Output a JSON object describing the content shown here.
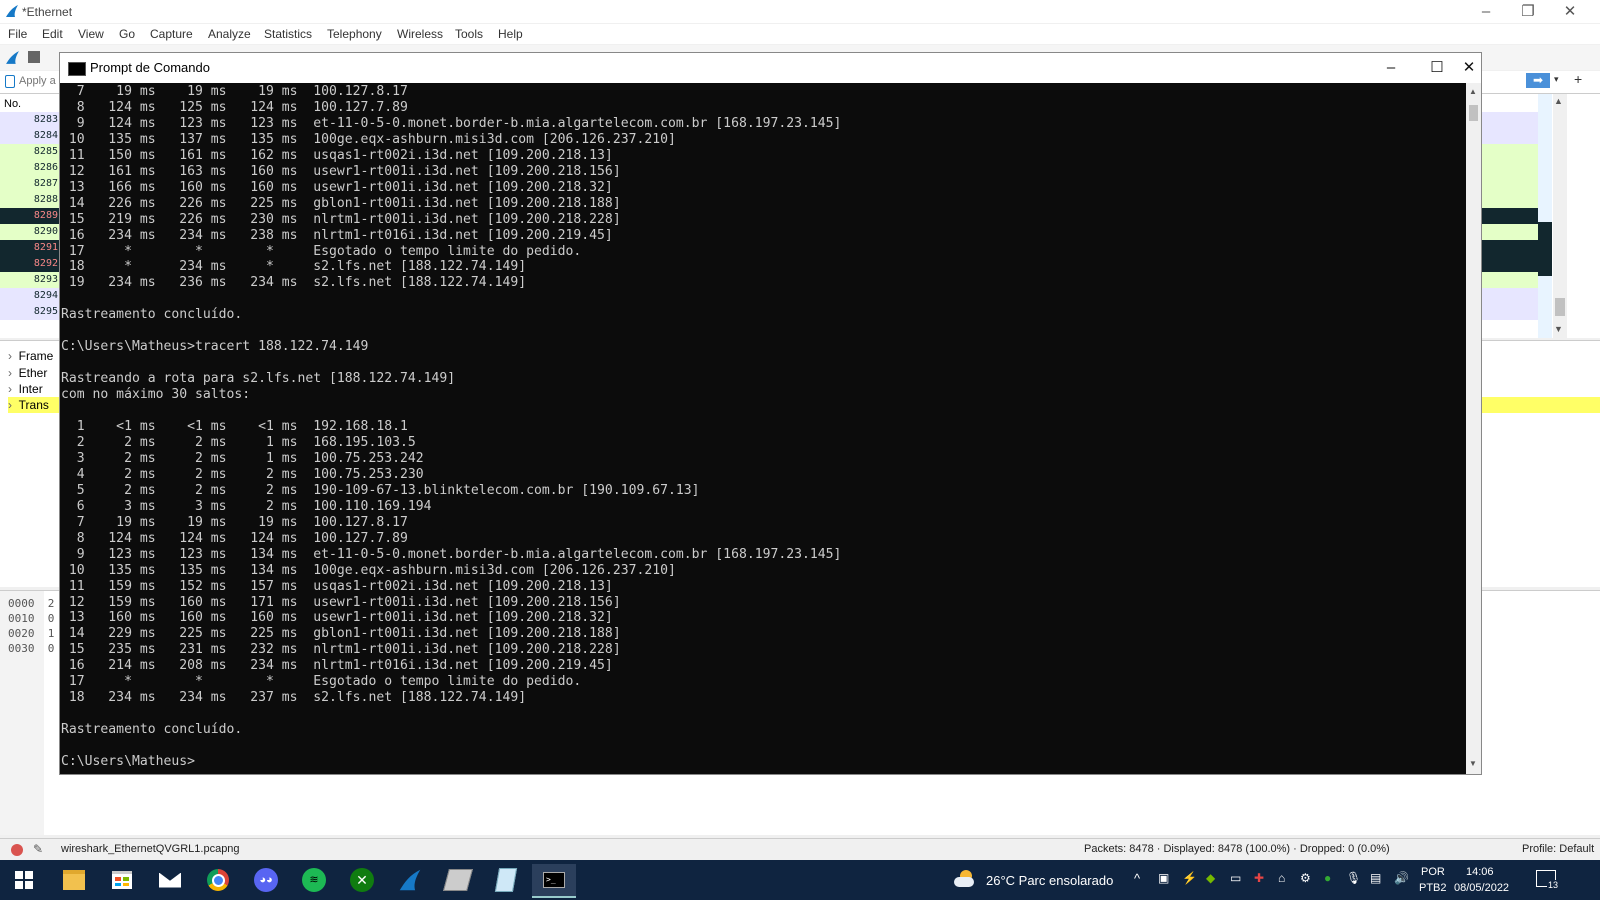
{
  "wireshark": {
    "title": "*Ethernet",
    "menu": [
      "File",
      "Edit",
      "View",
      "Go",
      "Capture",
      "Analyze",
      "Statistics",
      "Telephony",
      "Wireless",
      "Tools",
      "Help"
    ],
    "filter_placeholder": "Apply a",
    "list_header_no": "No.",
    "packets": [
      {
        "no": "8283",
        "bg": "#e7e6ff",
        "fg": "#12272e"
      },
      {
        "no": "8284",
        "bg": "#e7e6ff",
        "fg": "#12272e"
      },
      {
        "no": "8285",
        "bg": "#e4ffc7",
        "fg": "#12272e"
      },
      {
        "no": "8286",
        "bg": "#e4ffc7",
        "fg": "#12272e"
      },
      {
        "no": "8287",
        "bg": "#e4ffc7",
        "fg": "#12272e"
      },
      {
        "no": "8288",
        "bg": "#e4ffc7",
        "fg": "#12272e"
      },
      {
        "no": "8289",
        "bg": "#12272e",
        "fg": "#f78787"
      },
      {
        "no": "8290",
        "bg": "#e4ffc7",
        "fg": "#12272e"
      },
      {
        "no": "8291",
        "bg": "#12272e",
        "fg": "#f78787"
      },
      {
        "no": "8292",
        "bg": "#12272e",
        "fg": "#f78787"
      },
      {
        "no": "8293",
        "bg": "#e4ffc7",
        "fg": "#12272e"
      },
      {
        "no": "8294",
        "bg": "#e7e6ff",
        "fg": "#12272e"
      },
      {
        "no": "8295",
        "bg": "#e7e6ff",
        "fg": "#12272e"
      }
    ],
    "details": [
      "Frame",
      "Ether",
      "Inter",
      "Trans"
    ],
    "hex_offsets": [
      "0000",
      "0010",
      "0020",
      "0030"
    ],
    "hex_peek": [
      "2",
      "0",
      "1",
      "0"
    ],
    "status": {
      "file": "wireshark_EthernetQVGRL1.pcapng",
      "packets": "Packets: 8478 · Displayed: 8478 (100.0%) · Dropped: 0 (0.0%)",
      "profile": "Profile: Default"
    }
  },
  "cmd": {
    "title": "Prompt de Comando",
    "lines": [
      "  7    19 ms    19 ms    19 ms  100.127.8.17",
      "  8   124 ms   125 ms   124 ms  100.127.7.89",
      "  9   124 ms   123 ms   123 ms  et-11-0-5-0.monet.border-b.mia.algartelecom.com.br [168.197.23.145]",
      " 10   135 ms   137 ms   135 ms  100ge.eqx-ashburn.misi3d.com [206.126.237.210]",
      " 11   150 ms   161 ms   162 ms  usqas1-rt002i.i3d.net [109.200.218.13]",
      " 12   161 ms   163 ms   160 ms  usewr1-rt001i.i3d.net [109.200.218.156]",
      " 13   166 ms   160 ms   160 ms  usewr1-rt001i.i3d.net [109.200.218.32]",
      " 14   226 ms   226 ms   225 ms  gblon1-rt001i.i3d.net [109.200.218.188]",
      " 15   219 ms   226 ms   230 ms  nlrtm1-rt001i.i3d.net [109.200.218.228]",
      " 16   234 ms   234 ms   238 ms  nlrtm1-rt016i.i3d.net [109.200.219.45]",
      " 17     *        *        *     Esgotado o tempo limite do pedido.",
      " 18     *      234 ms     *     s2.lfs.net [188.122.74.149]",
      " 19   234 ms   236 ms   234 ms  s2.lfs.net [188.122.74.149]",
      "",
      "Rastreamento concluído.",
      "",
      "C:\\Users\\Matheus>tracert 188.122.74.149",
      "",
      "Rastreando a rota para s2.lfs.net [188.122.74.149]",
      "com no máximo 30 saltos:",
      "",
      "  1    <1 ms    <1 ms    <1 ms  192.168.18.1",
      "  2     2 ms     2 ms     1 ms  168.195.103.5",
      "  3     2 ms     2 ms     1 ms  100.75.253.242",
      "  4     2 ms     2 ms     2 ms  100.75.253.230",
      "  5     2 ms     2 ms     2 ms  190-109-67-13.blinktelecom.com.br [190.109.67.13]",
      "  6     3 ms     3 ms     2 ms  100.110.169.194",
      "  7    19 ms    19 ms    19 ms  100.127.8.17",
      "  8   124 ms   124 ms   124 ms  100.127.7.89",
      "  9   123 ms   123 ms   134 ms  et-11-0-5-0.monet.border-b.mia.algartelecom.com.br [168.197.23.145]",
      " 10   135 ms   135 ms   134 ms  100ge.eqx-ashburn.misi3d.com [206.126.237.210]",
      " 11   159 ms   152 ms   157 ms  usqas1-rt002i.i3d.net [109.200.218.13]",
      " 12   159 ms   160 ms   171 ms  usewr1-rt001i.i3d.net [109.200.218.156]",
      " 13   160 ms   160 ms   160 ms  usewr1-rt001i.i3d.net [109.200.218.32]",
      " 14   229 ms   225 ms   225 ms  gblon1-rt001i.i3d.net [109.200.218.188]",
      " 15   235 ms   231 ms   232 ms  nlrtm1-rt001i.i3d.net [109.200.218.228]",
      " 16   214 ms   208 ms   234 ms  nlrtm1-rt016i.i3d.net [109.200.219.45]",
      " 17     *        *        *     Esgotado o tempo limite do pedido.",
      " 18   234 ms   234 ms   237 ms  s2.lfs.net [188.122.74.149]",
      "",
      "Rastreamento concluído.",
      "",
      "C:\\Users\\Matheus>"
    ]
  },
  "taskbar": {
    "weather": "26°C  Parc ensolarado",
    "lang_top": "POR",
    "lang_bottom": "PTB2",
    "time": "14:06",
    "date": "08/05/2022",
    "notifications": "13"
  },
  "colors": {
    "taskbar": "#0f2440",
    "console_bg": "#0c0c0c",
    "console_fg": "#cccccc",
    "selected_row": "#12272e"
  }
}
